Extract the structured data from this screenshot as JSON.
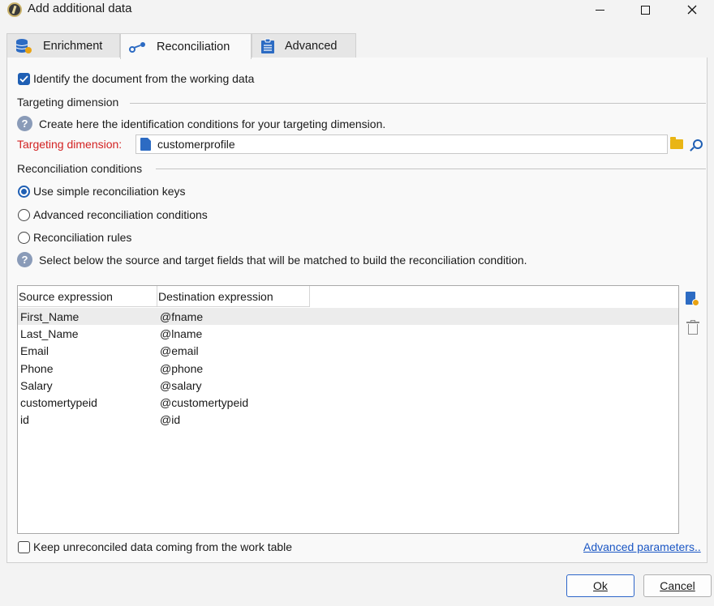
{
  "window": {
    "title": "Add additional data",
    "app_icon": "app-logo-icon",
    "controls": [
      "minimize-icon",
      "maximize-icon",
      "close-icon"
    ]
  },
  "tabs": [
    {
      "label": "Enrichment",
      "icon": "database-icon",
      "active": false
    },
    {
      "label": "Reconciliation",
      "icon": "link-icon",
      "active": true
    },
    {
      "label": "Advanced",
      "icon": "clipboard-icon",
      "active": false
    }
  ],
  "identify": {
    "label": "Identify the document from the working data",
    "checked": true
  },
  "targeting": {
    "section_title": "Targeting dimension",
    "help_text": "Create here the identification conditions for your targeting dimension.",
    "field_label": "Targeting dimension:",
    "field_value": "customerprofile",
    "label_color": "#d32323"
  },
  "reconciliation": {
    "section_title": "Reconciliation conditions",
    "options": [
      {
        "label": "Use simple reconciliation keys",
        "selected": true
      },
      {
        "label": "Advanced reconciliation conditions",
        "selected": false
      },
      {
        "label": "Reconciliation rules",
        "selected": false
      }
    ],
    "help_text": "Select below the source and target fields that will be matched to build the reconciliation condition."
  },
  "grid": {
    "columns": [
      "Source expression",
      "Destination expression"
    ],
    "rows": [
      {
        "source": "First_Name",
        "destination": "@fname",
        "selected": true
      },
      {
        "source": "Last_Name",
        "destination": "@lname",
        "selected": false
      },
      {
        "source": "Email",
        "destination": "@email",
        "selected": false
      },
      {
        "source": "Phone",
        "destination": "@phone",
        "selected": false
      },
      {
        "source": "Salary",
        "destination": "@salary",
        "selected": false
      },
      {
        "source": "customertypeid",
        "destination": "@customertypeid",
        "selected": false
      },
      {
        "source": "id",
        "destination": "@id",
        "selected": false
      }
    ]
  },
  "keep_unreconciled": {
    "label": "Keep unreconciled data coming from the work table",
    "checked": false
  },
  "advanced_link": "Advanced parameters..",
  "buttons": {
    "ok": "Ok",
    "cancel": "Cancel"
  },
  "colors": {
    "accent": "#1f5fb4",
    "link": "#1a56c4"
  }
}
